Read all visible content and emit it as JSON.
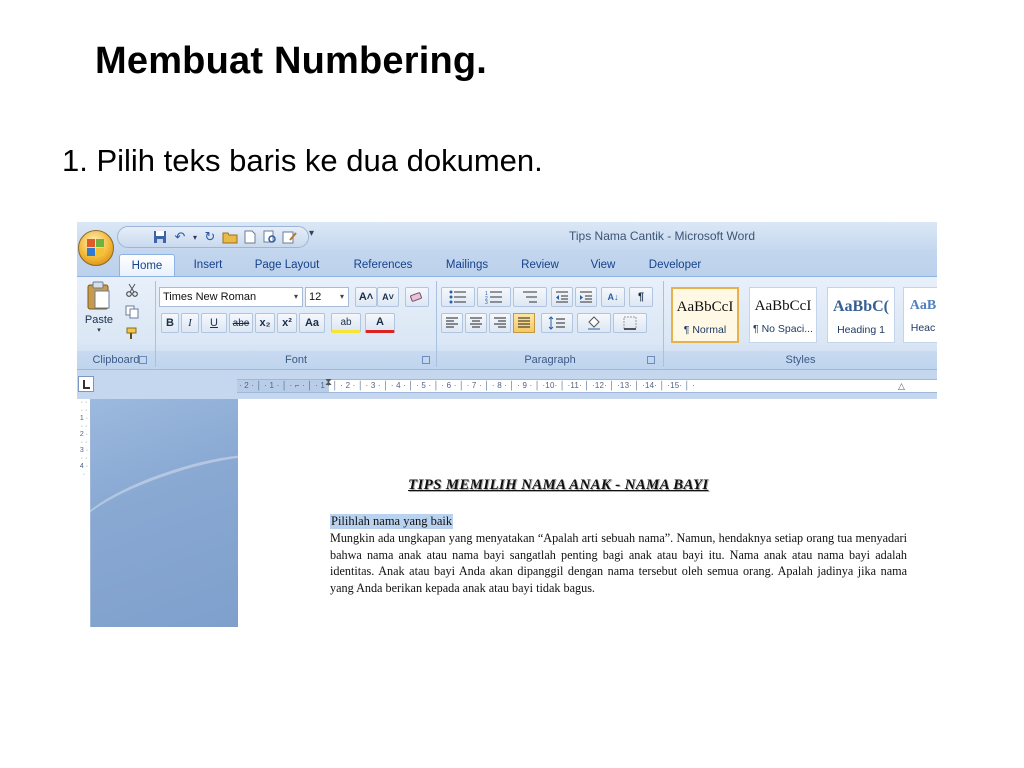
{
  "slide": {
    "title": "Membuat Numbering.",
    "step": "1. Pilih teks baris ke dua dokumen."
  },
  "word": {
    "window_title": "Tips  Nama Cantik - Microsoft Word",
    "qat_dropdown": "▾",
    "tabs": [
      "Home",
      "Insert",
      "Page Layout",
      "References",
      "Mailings",
      "Review",
      "View",
      "Developer"
    ],
    "active_tab": "Home",
    "clipboard": {
      "paste_label": "Paste",
      "group_label": "Clipboard"
    },
    "font": {
      "family": "Times New Roman",
      "size": "12",
      "grow": "A˄",
      "shrink": "A˅",
      "bold": "B",
      "italic": "I",
      "underline": "U",
      "strike": "abe",
      "subscript": "x₂",
      "superscript": "x²",
      "change_case": "Aa",
      "highlight": "ab",
      "font_color": "A",
      "group_label": "Font"
    },
    "paragraph": {
      "show_marks": "¶",
      "sort": "A↓",
      "group_label": "Paragraph"
    },
    "styles": {
      "items": [
        {
          "sample": "AaBbCcI",
          "name": "¶ Normal"
        },
        {
          "sample": "AaBbCcI",
          "name": "¶ No Spaci..."
        },
        {
          "sample": "AaBbC(",
          "name": "Heading 1"
        },
        {
          "sample": "AaB",
          "name": "Heac"
        }
      ],
      "selected_index": 0,
      "group_label": "Styles"
    },
    "ruler": {
      "horizontal": "· 2 · │ · 1 · │ · ⌐ · │ · 1 · │ · 2 · │ · 3 · │ · 4 · │ · 5 · │ · 6 · │ · 7 · │ · 8 · │ · 9 · │ ·10· │ ·11· │ ·12· │ ·13· │ ·14· │ ·15· │ ·",
      "vertical": "· · · · 1 · · · 2 · · · 3 · · · 4 · ·"
    },
    "document": {
      "heading": "TIPS MEMILIH NAMA ANAK - NAMA BAYI",
      "selected_line": "Pilihlah nama yang baik",
      "body": "Mungkin ada ungkapan yang menyatakan “Apalah arti sebuah nama”. Namun, hendaknya setiap orang tua menyadari bahwa nama anak atau nama bayi sangatlah penting bagi anak atau bayi itu. Nama anak atau nama bayi adalah identitas. Anak atau bayi Anda akan dipanggil dengan nama tersebut oleh semua orang. Apalah jadinya jika nama yang Anda berikan kepada anak atau bayi tidak bagus."
    }
  }
}
